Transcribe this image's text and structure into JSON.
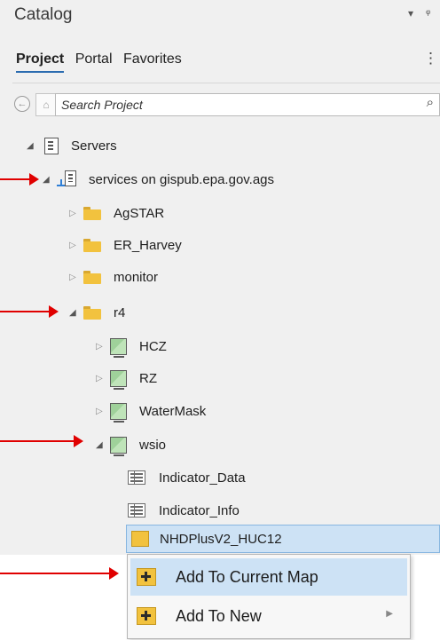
{
  "pane": {
    "title": "Catalog",
    "menu_glyph": "▾",
    "pin_glyph": "ᵠ",
    "more_glyph": "⋮"
  },
  "tabs": [
    {
      "label": "Project",
      "active": true
    },
    {
      "label": "Portal",
      "active": false
    },
    {
      "label": "Favorites",
      "active": false
    }
  ],
  "search": {
    "placeholder": "Search Project",
    "back_glyph": "←",
    "home_glyph": "⌂",
    "search_glyph": "⌕"
  },
  "tree": {
    "expanded_glyph": "◢",
    "collapsed_glyph": "▷",
    "servers": "Servers",
    "connection": "services on gispub.epa.gov.ags",
    "folders": [
      "AgSTAR",
      "ER_Harvey",
      "monitor"
    ],
    "r4": "r4",
    "r4_services": [
      "HCZ",
      "RZ",
      "WaterMask"
    ],
    "wsio": "wsio",
    "wsio_items": [
      "Indicator_Data",
      "Indicator_Info"
    ],
    "selected_item": "NHDPlusV2_HUC12"
  },
  "context_menu": {
    "items": [
      "Add To Current Map",
      "Add To New"
    ],
    "submenu_glyph": "▶"
  },
  "colors": {
    "folder": "#f2c23e",
    "selection": "#cde2f5",
    "annotation_arrow": "#e00000"
  }
}
